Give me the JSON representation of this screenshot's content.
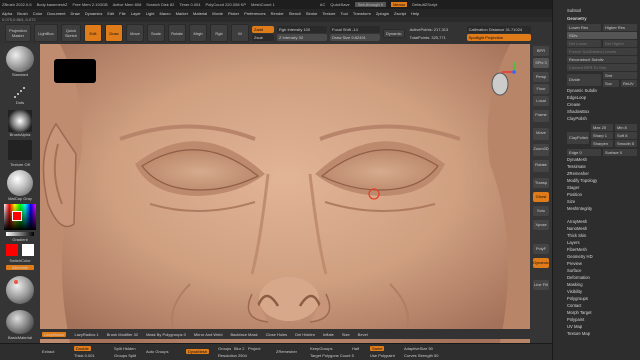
{
  "titlebar": {
    "items": [
      "ZBrush 2022.0.6",
      "Body kasemeshZ",
      "Free Mem 2.193GB",
      "Active Mem 808",
      "Scratch Disk 82",
      "Timer 0.004",
      "PolyCount 220.058 KP",
      "MeshCount 1"
    ],
    "right": [
      "AC",
      "QuickSave",
      "See-through 0",
      "Menus",
      "DefaultZScript"
    ]
  },
  "menubar": [
    "Alpha",
    "Brush",
    "Color",
    "Document",
    "Draw",
    "Dynamics",
    "Edit",
    "File",
    "Layer",
    "Light",
    "Macro",
    "Marker",
    "Material",
    "Movie",
    "Picker",
    "Preferences",
    "Render",
    "Stencil",
    "Stroke",
    "Texture",
    "Tool",
    "Transform",
    "Zplugin",
    "Zscript",
    "Help"
  ],
  "coords": "0.075,0.863,-0.072",
  "shelf": {
    "projection_master": "Projection Master",
    "lightbox": "LightBox",
    "quick_sketch": "Quick Sketch",
    "edit": "Edit",
    "draw": "Draw",
    "move": "Move",
    "scale": "Scale",
    "rotate": "Rotate",
    "mrgb": "Mrgb",
    "rgb": "Rgb",
    "m": "M",
    "zadd": "Zadd",
    "zsub": "Zsub",
    "zcut": "Zcut",
    "rgb_intensity": "Rgb Intensity 100",
    "z_intensity": "Z Intensity 33",
    "focal_shift": "Focal Shift -14",
    "draw_size": "Draw Size 9.82491",
    "dynamic": "Dynamic",
    "active_points": "ActivePoints: 217,313",
    "total_points": "TotalPoints: 325,771",
    "calibration": "Calibration Distance 31.71024",
    "spotlight": "Spotlight Projection"
  },
  "left": {
    "brush": "Standard",
    "stroke": "Dots",
    "alpha": "BrushAlpha",
    "texture": "Texture Off",
    "material": "MatCap Gray",
    "gradient": "Gradient",
    "switch_color": "SwitchColor",
    "alternate": "Alternate",
    "basic_material": "BasicMaterial"
  },
  "right": {
    "bpr": "BPR",
    "spix": "SPix 3",
    "persp": "Persp",
    "floor": "Floor",
    "local": "Local",
    "frame": "Frame",
    "move": "Move",
    "zoom3d": "Zoom3D",
    "rotate": "Rotate",
    "transp": "Transp",
    "ghost": "Ghost",
    "solo": "Solo",
    "xpose": "Xpose",
    "polyf": "PolyF",
    "dynamic": "Dynamic",
    "line_fill": "Line Fill"
  },
  "tray": {
    "subtool": "Subtool",
    "geometry": "Geometry",
    "lower_res": "Lower Res",
    "higher_res": "Higher Res",
    "sdiv": "SDiv",
    "del_lower": "Del Lower",
    "del_higher": "Del Higher",
    "freeze": "Freeze SubDivision Levels",
    "reconstruct": "Reconstruct Subdiv",
    "convert_bpr": "Convert BPR To Geo",
    "divide": "Divide",
    "smt": "Smt",
    "suv": "Suv",
    "reuv": "ReUV",
    "dynamic_subdiv": "Dynamic Subdiv",
    "edge_loop": "EdgeLoop",
    "crease": "Crease",
    "shadowbox": "ShadowBox",
    "claypolish": "ClayPolish",
    "claypolish_btn": "ClayPolish",
    "max_angle": "Max 25",
    "min": "Min 8",
    "sharp": "Sharp 1",
    "soft": "Soft 8",
    "sharpen": "Sharpen 40",
    "smooth": "Smooth 5",
    "edge": "Edge 0",
    "surface": "Surface 0",
    "items": [
      "DynaMesh",
      "Tessimate",
      "ZRemesher",
      "Modify Topology",
      "Stager",
      "Position",
      "Size",
      "MeshIntegrity",
      "ArrayMesh",
      "NanoMesh",
      "Thick Skin",
      "Layers",
      "FiberMesh",
      "Geometry HD",
      "Preview",
      "Surface",
      "Deformation",
      "Masking",
      "Visibility",
      "Polygroups",
      "Contact",
      "Morph Target",
      "Polypaint",
      "UV Map",
      "Texture Map"
    ]
  },
  "bottom1": [
    "LazyMouse",
    "LazyRadius 1",
    "Brush Modifier 32",
    "Mask By Polygroups 0",
    "Mirror And Weld",
    "Backface Mask",
    "Close Holes",
    "Del Hidden",
    "Inflate",
    "Size",
    "Bevel"
  ],
  "bottom2": {
    "extract": "Extract",
    "double": "Double",
    "thick": "Thick 0.001",
    "split_hidden": "Split Hidden",
    "groups_split": "Groups Split",
    "auto_groups": "Auto Groups",
    "dynamesh": "DynaMesh",
    "groups": "Groups",
    "project": "Project",
    "blur": "Blur 2",
    "resolution": "Resolution 2504",
    "zremesher": "ZRemesher",
    "keep_groups": "KeepGroups",
    "target_count": "Target Polygons Count 5",
    "half": "Half",
    "same": "Same",
    "use_polypaint": "Use Polypaint",
    "adaptive_size": "AdaptiveSize 50",
    "curves_strength": "Curves Strength 50"
  },
  "colors": {
    "accent": "#e07b1a",
    "skin": "#c99a7c"
  }
}
